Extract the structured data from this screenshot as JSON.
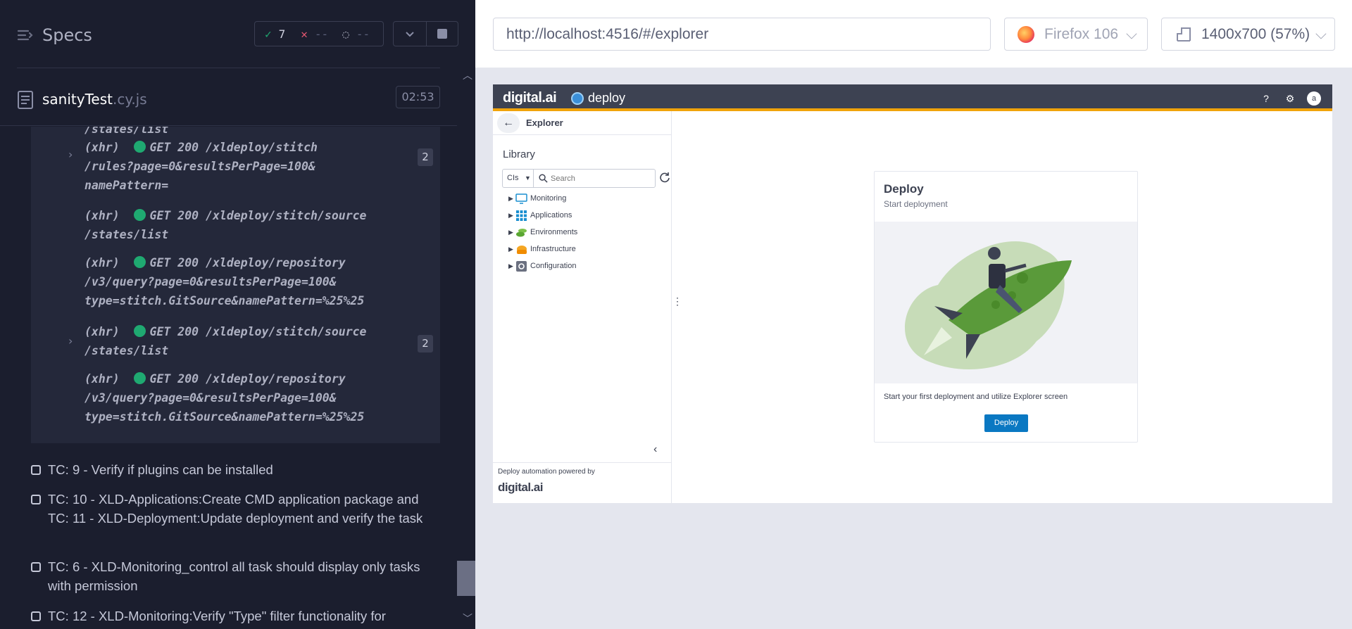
{
  "reporter": {
    "specs_label": "Specs",
    "stats": {
      "passed": "7",
      "failed": "--",
      "pending": "--"
    },
    "file": {
      "name": "sanityTest",
      "ext": ".cy.js",
      "duration": "02:53"
    },
    "log_lines": [
      {
        "text": "/states/list",
        "dot": false
      },
      {
        "text": "(xhr)  ",
        "rest": "GET 200 /xldeploy/stitch",
        "dot": true
      },
      {
        "text": "/rules?page=0&resultsPerPage=100&",
        "dot": false
      },
      {
        "text": "namePattern=",
        "dot": false
      },
      {
        "text": "(xhr)  ",
        "rest": "GET 200 /xldeploy/stitch/source",
        "dot": true
      },
      {
        "text": "/states/list",
        "dot": false
      },
      {
        "text": "(xhr)  ",
        "rest": "GET 200 /xldeploy/repository",
        "dot": true
      },
      {
        "text": "/v3/query?page=0&resultsPerPage=100&",
        "dot": false
      },
      {
        "text": "type=stitch.GitSource&namePattern=%25%25",
        "dot": false
      },
      {
        "text": "(xhr)  ",
        "rest": "GET 200 /xldeploy/stitch/source",
        "dot": true
      },
      {
        "text": "/states/list",
        "dot": false
      },
      {
        "text": "(xhr)  ",
        "rest": "GET 200 /xldeploy/repository",
        "dot": true
      },
      {
        "text": "/v3/query?page=0&resultsPerPage=100&",
        "dot": false
      },
      {
        "text": "type=stitch.GitSource&namePattern=%25%25",
        "dot": false
      }
    ],
    "badges": [
      "2",
      "2"
    ],
    "tests": [
      "TC: 9 - Verify if plugins can be installed",
      "TC: 10 - XLD-Applications:Create CMD application package and TC: 11 - XLD-Deployment:Update deployment and verify the task",
      "TC: 6 - XLD-Monitoring_control all task should display only tasks with permission",
      "TC: 12 - XLD-Monitoring:Verify \"Type\" filter functionality for"
    ]
  },
  "aut": {
    "url": "http://localhost:4516/#/explorer",
    "browser": "Firefox 106",
    "viewport": "1400x700",
    "scale": "(57%)"
  },
  "app": {
    "brand": "digital.ai",
    "product": "deploy",
    "avatar_letter": "a",
    "explorer_label": "Explorer",
    "library_label": "Library",
    "filter_select": "CIs",
    "search_placeholder": "Search",
    "tree": [
      {
        "label": "Monitoring",
        "icon": "monitor-icon"
      },
      {
        "label": "Applications",
        "icon": "applications-grid-icon"
      },
      {
        "label": "Environments",
        "icon": "environments-icon"
      },
      {
        "label": "Infrastructure",
        "icon": "infrastructure-icon"
      },
      {
        "label": "Configuration",
        "icon": "configuration-gear-icon"
      }
    ],
    "powered_by": "Deploy automation powered by",
    "powered_brand": "digital.ai",
    "card": {
      "title": "Deploy",
      "subtitle": "Start deployment",
      "description": "Start your first deployment and utilize Explorer screen",
      "button": "Deploy"
    }
  }
}
